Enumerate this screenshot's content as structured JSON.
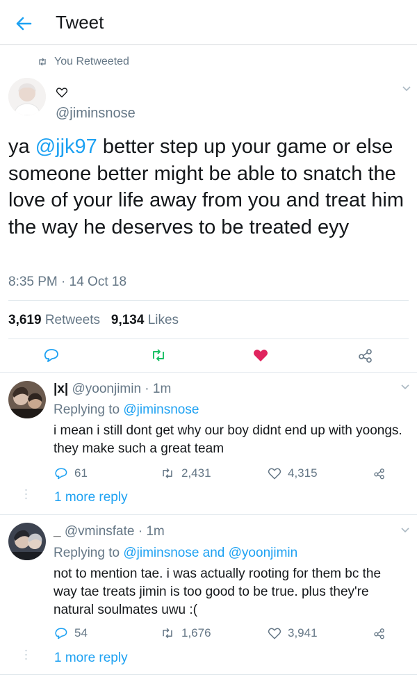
{
  "header": {
    "title": "Tweet",
    "back_icon": "arrow-left-icon"
  },
  "retweet_context": {
    "label": "You Retweeted"
  },
  "tweet": {
    "display_name": "♡",
    "handle": "@jiminsnose",
    "text_prefix": "ya ",
    "mention": "@jjk97",
    "text_rest": " better step up your game or else someone better might be able to snatch the love of your life away from you and treat him the way he deserves to be treated eyy",
    "time": "8:35 PM · 14 Oct 18",
    "retweets_count": "3,619",
    "retweets_label": "Retweets",
    "likes_count": "9,134",
    "likes_label": "Likes",
    "liked": true
  },
  "replies": [
    {
      "display_name": "|x|",
      "handle_time": " @yoonjimin · 1m",
      "replying_prefix": "Replying to ",
      "replying_to": "@jiminsnose",
      "text": "i mean i still dont get why our boy didnt end up with yoongs. they make such a great team",
      "reply_count": "61",
      "retweet_count": "2,431",
      "like_count": "4,315",
      "more": "1 more reply"
    },
    {
      "display_name": "_",
      "handle_time": " @vminsfate · 1m",
      "replying_prefix": "Replying to ",
      "replying_to": "@jiminsnose and @yoonjimin",
      "text": "not to mention tae. i was actually rooting for them bc the way tae treats jimin is too good to be true. plus they're natural soulmates uwu :(",
      "reply_count": "54",
      "retweet_count": "1,676",
      "like_count": "3,941",
      "more": "1 more reply"
    }
  ],
  "colors": {
    "accent": "#1da1f2",
    "like": "#e0245e",
    "retweet": "#17bf63",
    "muted": "#657786"
  }
}
